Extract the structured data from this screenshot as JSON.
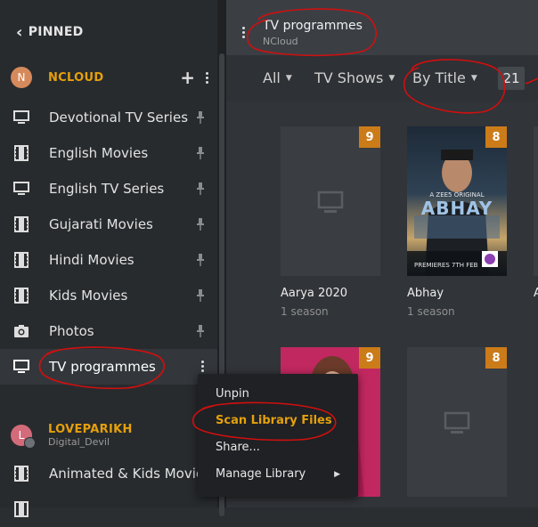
{
  "sidebar": {
    "pinned_label": "PINNED",
    "servers": [
      {
        "initial": "N",
        "name": "NCLOUD",
        "avatar_color": "#d68a5c"
      },
      {
        "initial": "L",
        "name": "LOVEPARIKH",
        "subtitle": "Digital_Devil",
        "avatar_color": "#d46b7a"
      }
    ],
    "libraries": [
      {
        "label": "Devotional TV Series",
        "icon": "tv-icon"
      },
      {
        "label": "English Movies",
        "icon": "film-icon"
      },
      {
        "label": "English TV Series",
        "icon": "tv-icon"
      },
      {
        "label": "Gujarati Movies",
        "icon": "film-icon"
      },
      {
        "label": "Hindi Movies",
        "icon": "film-icon"
      },
      {
        "label": "Kids Movies",
        "icon": "film-icon"
      },
      {
        "label": "Photos",
        "icon": "camera-icon"
      },
      {
        "label": "TV programmes",
        "icon": "tv-icon",
        "active": true
      }
    ],
    "second_server_libraries": [
      {
        "label": "Animated & Kids Movie",
        "icon": "film-icon"
      }
    ]
  },
  "header": {
    "title": "TV programmes",
    "subtitle": "NCloud"
  },
  "filters": {
    "all": "All",
    "type": "TV Shows",
    "sort": "By Title",
    "count": "21"
  },
  "cards": [
    {
      "title": "Aarya 2020",
      "subtitle": "1 season",
      "badge": "9",
      "has_poster": false
    },
    {
      "title": "Abhay",
      "subtitle": "1 season",
      "badge": "8",
      "has_poster": true,
      "poster_text": "ABHAY",
      "poster_top": "A ZEE5 ORIGINAL",
      "poster_bottom": "PREMIERES 7TH FEB"
    },
    {
      "title": "",
      "subtitle": "",
      "badge": "9",
      "has_poster": true
    },
    {
      "title": "",
      "subtitle": "",
      "badge": "8",
      "has_poster": false
    }
  ],
  "context_menu": {
    "items": [
      "Unpin",
      "Scan Library Files",
      "Share...",
      "Manage Library"
    ]
  },
  "colors": {
    "accent": "#e5a00d",
    "badge": "#cc7b19",
    "annotation": "#d10f0f"
  }
}
